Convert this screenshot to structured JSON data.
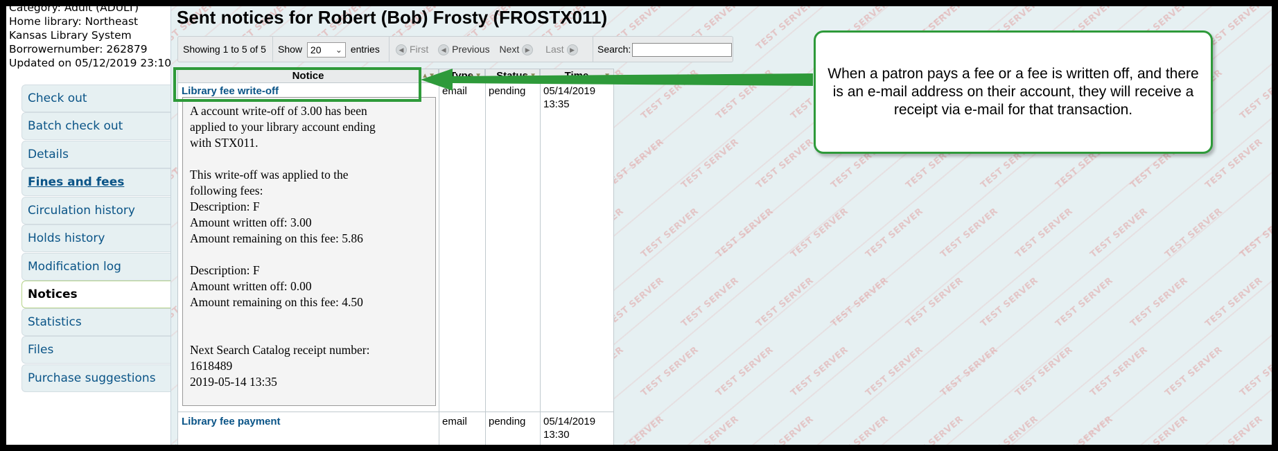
{
  "patron": {
    "lines": [
      "Category: Adult (ADULT)",
      "Home library: Northeast",
      "Kansas Library System",
      "Borrowernumber: 262879",
      "Updated on 05/12/2019 23:10"
    ]
  },
  "sidebar": {
    "items": [
      {
        "label": "Check out"
      },
      {
        "label": "Batch check out"
      },
      {
        "label": "Details"
      },
      {
        "label": "Fines and fees"
      },
      {
        "label": "Circulation history"
      },
      {
        "label": "Holds history"
      },
      {
        "label": "Modification log"
      },
      {
        "label": "Notices"
      },
      {
        "label": "Statistics"
      },
      {
        "label": "Files"
      },
      {
        "label": "Purchase suggestions"
      }
    ],
    "active": "Notices"
  },
  "page": {
    "title": "Sent notices for Robert (Bob) Frosty (FROSTX011)"
  },
  "toolbar": {
    "showing": "Showing 1 to 5 of 5",
    "show_label": "Show",
    "show_value": "20",
    "entries_label": "entries",
    "first": "First",
    "previous": "Previous",
    "next": "Next",
    "last": "Last",
    "search_label": "Search:",
    "search_value": ""
  },
  "table": {
    "headers": [
      "Notice",
      "Type",
      "Status",
      "Time"
    ],
    "rows": [
      {
        "notice": "Library fee write-off",
        "type": "email",
        "status": "pending",
        "time_date": "05/14/2019",
        "time_clock": "13:35",
        "body": [
          [
            "A account write-off of 3.00 has been",
            "applied to your library account ending",
            "with STX011."
          ],
          [
            "This write-off was applied to the",
            "following fees:",
            "Description: F",
            "Amount written off: 3.00",
            "Amount remaining on this fee: 5.86"
          ],
          [
            "Description: F",
            "Amount written off: 0.00",
            "Amount remaining on this fee: 4.50"
          ],
          [
            "Next Search Catalog receipt number:",
            "1618489",
            "2019-05-14 13:35"
          ]
        ]
      },
      {
        "notice": "Library fee payment",
        "type": "email",
        "status": "pending",
        "time_date": "05/14/2019",
        "time_clock": "13:30"
      }
    ]
  },
  "callout": {
    "text": "When a patron pays a fee or a fee is written off, and there is an e-mail address on their account, they will receive a receipt via e-mail for that transaction."
  },
  "watermark": {
    "text": "TEST SERVER",
    "color": "#dc7878"
  },
  "colors": {
    "highlight": "#2e9a3a",
    "link": "#0a5487",
    "main_bg": "#e6f0f2"
  }
}
